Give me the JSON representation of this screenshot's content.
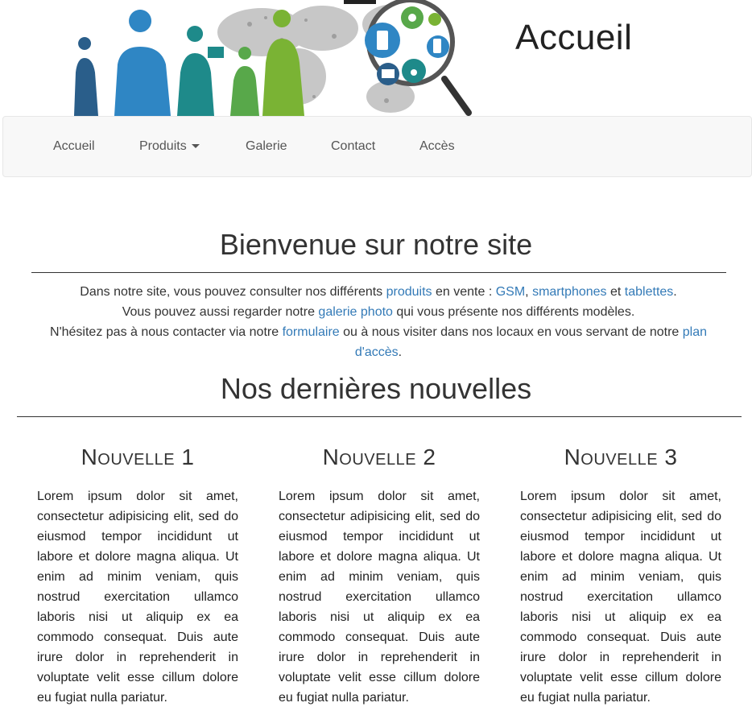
{
  "header": {
    "title": "Accueil"
  },
  "nav": {
    "items": [
      {
        "label": "Accueil"
      },
      {
        "label": "Produits"
      },
      {
        "label": "Galerie"
      },
      {
        "label": "Contact"
      },
      {
        "label": "Accès"
      }
    ]
  },
  "welcome": {
    "title": "Bienvenue sur notre site",
    "line1_a": "Dans notre site, vous pouvez consulter nos différents ",
    "link_produits": "produits",
    "line1_b": " en vente : ",
    "link_gsm": "GSM",
    "sep_comma": ", ",
    "link_smartphones": "smartphones",
    "sep_et": " et ",
    "link_tablettes": "tablettes",
    "line1_end": ".",
    "line2_a": "Vous pouvez aussi regarder notre ",
    "link_galerie": "galerie photo",
    "line2_b": " qui vous présente nos différents modèles.",
    "line3_a": "N'hésitez pas à nous contacter via notre ",
    "link_formulaire": "formulaire",
    "line3_b": " ou à nous visiter dans nos locaux en vous servant de notre ",
    "link_plan": "plan d'accès",
    "line3_end": "."
  },
  "news": {
    "title": "Nos dernières nouvelles",
    "items": [
      {
        "title": "Nouvelle 1",
        "body": "Lorem ipsum dolor sit amet, consectetur adipisicing elit, sed do eiusmod tempor incididunt ut labore et dolore magna aliqua. Ut enim ad minim veniam, quis nostrud exercitation ullamco laboris nisi ut aliquip ex ea commodo consequat. Duis aute irure dolor in reprehenderit in voluptate velit esse cillum dolore eu fugiat nulla pariatur."
      },
      {
        "title": "Nouvelle 2",
        "body": "Lorem ipsum dolor sit amet, consectetur adipisicing elit, sed do eiusmod tempor incididunt ut labore et dolore magna aliqua. Ut enim ad minim veniam, quis nostrud exercitation ullamco laboris nisi ut aliquip ex ea commodo consequat. Duis aute irure dolor in reprehenderit in voluptate velit esse cillum dolore eu fugiat nulla pariatur."
      },
      {
        "title": "Nouvelle 3",
        "body": "Lorem ipsum dolor sit amet, consectetur adipisicing elit, sed do eiusmod tempor incididunt ut labore et dolore magna aliqua. Ut enim ad minim veniam, quis nostrud exercitation ullamco laboris nisi ut aliquip ex ea commodo consequat. Duis aute irure dolor in reprehenderit in voluptate velit esse cillum dolore eu fugiat nulla pariatur."
      }
    ]
  },
  "colors": {
    "link": "#337ab7",
    "navbar_bg": "#f8f8f8",
    "text": "#333333"
  }
}
